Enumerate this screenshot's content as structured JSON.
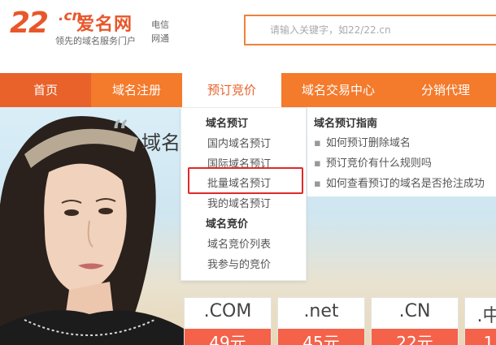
{
  "logo": {
    "number": "22",
    "cn": ".cn",
    "name": "爱名网",
    "tagline": "领先的域名服务门户",
    "isp_lines": [
      "电信",
      "网通"
    ]
  },
  "search": {
    "placeholder": "请输入关键字，如22/22.cn"
  },
  "nav": {
    "items": [
      {
        "label": "首页"
      },
      {
        "label": "域名注册"
      },
      {
        "label": "预订竞价"
      },
      {
        "label": "域名交易中心"
      },
      {
        "label": "分销代理"
      }
    ]
  },
  "dropdown": {
    "group1_title": "域名预订",
    "group1_items": [
      "国内域名预订",
      "国际域名预订",
      "批量域名预订",
      "我的域名预订"
    ],
    "group2_title": "域名竞价",
    "group2_items": [
      "域名竞价列表",
      "我参与的竞价"
    ]
  },
  "guide": {
    "title": "域名预订指南",
    "items": [
      "如何预订删除域名",
      "预订竞价有什么规则吗",
      "如何查看预订的域名是否抢注成功"
    ]
  },
  "banner": {
    "quote_mark": "“",
    "headline": "域名"
  },
  "cards": [
    {
      "ext": ".COM",
      "price": "49元"
    },
    {
      "ext": ".net",
      "price": "45元"
    },
    {
      "ext": ".CN",
      "price": "22元"
    },
    {
      "ext": ".中",
      "price": "1"
    }
  ],
  "colors": {
    "brand_orange": "#f47a2c",
    "nav_home": "#e8622a",
    "highlight_red": "#e02828",
    "price_red": "#f4624a"
  }
}
